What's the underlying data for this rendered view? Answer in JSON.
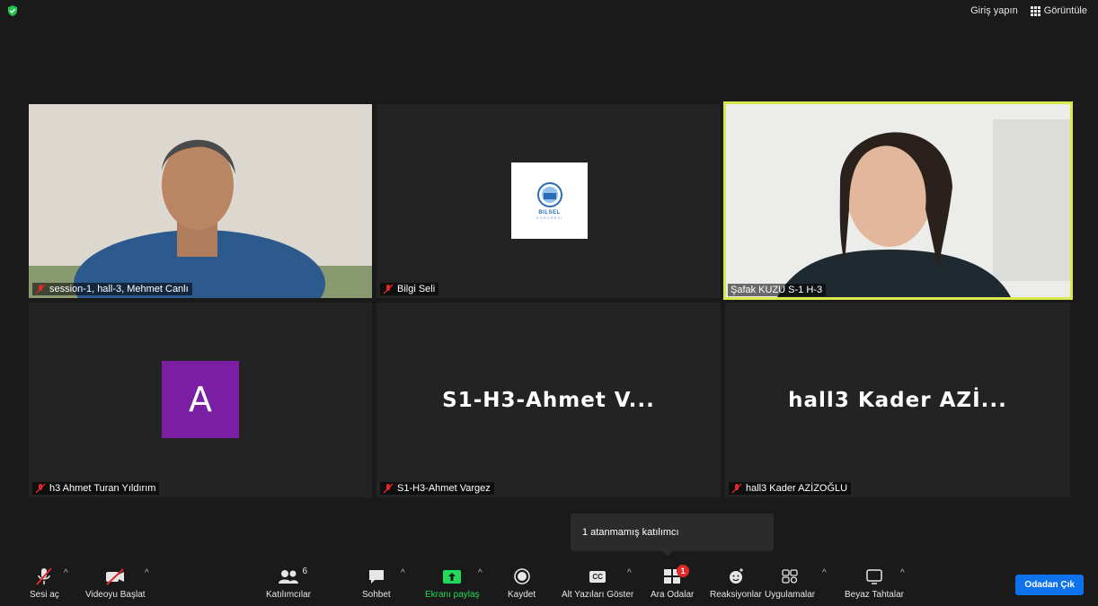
{
  "top": {
    "signin": "Giriş yapın",
    "view": "Görüntüle"
  },
  "tiles": [
    {
      "name": "session-1, hall-3, Mehmet Canlı"
    },
    {
      "name": "Bilgi Seli",
      "logo_text": "BILSEL",
      "logo_sub": "KONGRESİ"
    },
    {
      "name": "Şafak KUZU S-1 H-3"
    },
    {
      "name": "h3 Ahmet Turan Yıldırım",
      "avatar_letter": "A"
    },
    {
      "name": "S1-H3-Ahmet Vargez",
      "big": "S1-H3-Ahmet V..."
    },
    {
      "name": "hall3 Kader AZİZOĞLU",
      "big": "hall3 Kader AZİ..."
    }
  ],
  "tooltip": "1 atanmamış katılımcı",
  "toolbar": {
    "unmute": "Sesi aç",
    "start_video": "Videoyu Başlat",
    "participants": "Katılımcılar",
    "participants_count": "6",
    "chat": "Sohbet",
    "share": "Ekranı paylaş",
    "record": "Kaydet",
    "captions": "Alt Yazıları Göster",
    "breakout": "Ara Odalar",
    "breakout_badge": "1",
    "reactions": "Reaksiyonlar",
    "apps": "Uygulamalar",
    "whiteboard": "Beyaz Tahtalar",
    "cc": "CC",
    "leave": "Odadan Çık"
  },
  "colors": {
    "active_border": "#d9e84a",
    "share_green": "#23d959",
    "leave_blue": "#0e72ed",
    "avatar_purple": "#7a1fa3"
  }
}
